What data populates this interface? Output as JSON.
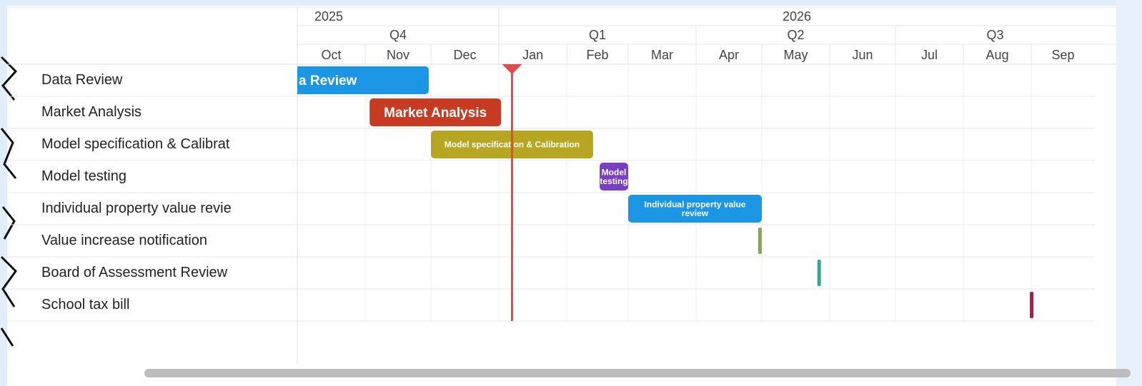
{
  "chart_data": {
    "type": "gantt",
    "years": [
      {
        "label": "2025",
        "start": "2025-10-01",
        "end": "2026-01-01"
      },
      {
        "label": "2026",
        "start": "2026-01-01",
        "end": "2026-09-30"
      }
    ],
    "quarters": [
      {
        "label": "Q4",
        "start": "2025-10-01",
        "end": "2026-01-01"
      },
      {
        "label": "Q1",
        "start": "2026-01-01",
        "end": "2026-04-01"
      },
      {
        "label": "Q2",
        "start": "2026-04-01",
        "end": "2026-07-01"
      },
      {
        "label": "Q3",
        "start": "2026-07-01",
        "end": "2026-09-30"
      }
    ],
    "months": [
      {
        "label": "Oct",
        "start": "2025-10-01"
      },
      {
        "label": "Nov",
        "start": "2025-11-01"
      },
      {
        "label": "Dec",
        "start": "2025-12-01"
      },
      {
        "label": "Jan",
        "start": "2026-01-01"
      },
      {
        "label": "Feb",
        "start": "2026-02-01"
      },
      {
        "label": "Mar",
        "start": "2026-03-01"
      },
      {
        "label": "Apr",
        "start": "2026-04-01"
      },
      {
        "label": "May",
        "start": "2026-05-01"
      },
      {
        "label": "Jun",
        "start": "2026-06-01"
      },
      {
        "label": "Jul",
        "start": "2026-07-01"
      },
      {
        "label": "Aug",
        "start": "2026-08-01"
      },
      {
        "label": "Sep",
        "start": "2026-09-01"
      }
    ],
    "x_range": [
      "2025-10-01",
      "2026-09-30"
    ],
    "today": "2026-01-07",
    "tasks": [
      {
        "name": "Data Review",
        "bar_label": "a Review",
        "start": "2025-09-15",
        "end": "2025-11-30",
        "color": "#1b96e4"
      },
      {
        "name": "Market Analysis",
        "bar_label": "Market Analysis",
        "start": "2025-11-03",
        "end": "2026-01-02",
        "color": "#c83b23"
      },
      {
        "name": "Model specification & Calibrat",
        "bar_label": "Model specification & Calibration",
        "start": "2025-12-01",
        "end": "2026-02-13",
        "color": "#b6a621"
      },
      {
        "name": "Model testing",
        "bar_label": "Model testing",
        "start": "2026-02-16",
        "end": "2026-03-01",
        "color": "#7a3fbf"
      },
      {
        "name": "Individual property value revie",
        "bar_label": "Individual property value review",
        "start": "2026-03-01",
        "end": "2026-05-01",
        "color": "#1b96e4"
      },
      {
        "name": "Value increase notification",
        "bar_label": "",
        "start": "2026-04-30",
        "end": "2026-05-01",
        "color": "#8aa64d"
      },
      {
        "name": "Board of Assessment Review",
        "bar_label": "",
        "start": "2026-05-27",
        "end": "2026-05-28",
        "color": "#3aa39a"
      },
      {
        "name": "School tax bill",
        "bar_label": "",
        "start": "2026-09-01",
        "end": "2026-09-02",
        "color": "#b0174a"
      }
    ]
  }
}
